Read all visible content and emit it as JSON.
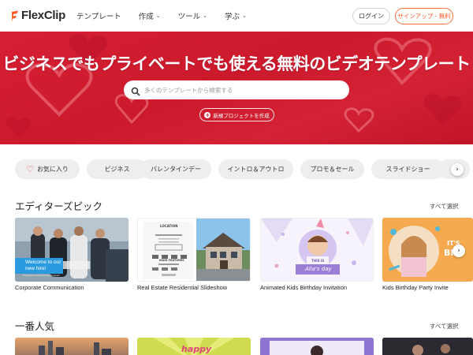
{
  "header": {
    "brand": "FlexClip",
    "nav": [
      {
        "label": "テンプレート",
        "has_menu": false
      },
      {
        "label": "作成",
        "has_menu": true
      },
      {
        "label": "ツール",
        "has_menu": true
      },
      {
        "label": "学ぶ",
        "has_menu": true
      }
    ],
    "login_label": "ログイン",
    "signup_label": "サインアップ - 無料"
  },
  "hero": {
    "title": "ビジネスでもプライベートでも使える無料のビデオテンプレート",
    "search_placeholder": "多くのテンプレートから検索する",
    "new_project_label": "新規プロジェクトを作成",
    "background_color": "#d61e33"
  },
  "categories": [
    "お気に入り",
    "ビジネス",
    "バレンタインデー",
    "イントロ＆アウトロ",
    "プロモ＆セール",
    "スライドショー"
  ],
  "sections": [
    {
      "title": "エディターズピック",
      "select_all": "すべて選択",
      "cards": [
        {
          "label": "Corporate Communication",
          "overlay": "Welcome to our new hire!",
          "overlay_sub": "Employee Onboarding Program"
        },
        {
          "label": "Real Estate Residential Slideshow",
          "overlay": "LOCATION",
          "overlay_sub": "MAIN FEATURES"
        },
        {
          "label": "Animated Kids Birthday Invitation",
          "overlay": "THIS IS",
          "overlay_sub": "Alia's day"
        },
        {
          "label": "Kids Birthday Party Invite",
          "overlay": "IT'S",
          "overlay_sub": "BI"
        }
      ]
    },
    {
      "title": "一番人気",
      "select_all": "すべて選択",
      "cards": [
        {
          "overlay": ""
        },
        {
          "overlay": "happy"
        },
        {
          "overlay": ""
        },
        {
          "overlay": ""
        }
      ]
    }
  ],
  "colors": {
    "accent": "#ff5a26",
    "hero_red": "#d61e33",
    "chip_bg": "#eeeeee"
  }
}
